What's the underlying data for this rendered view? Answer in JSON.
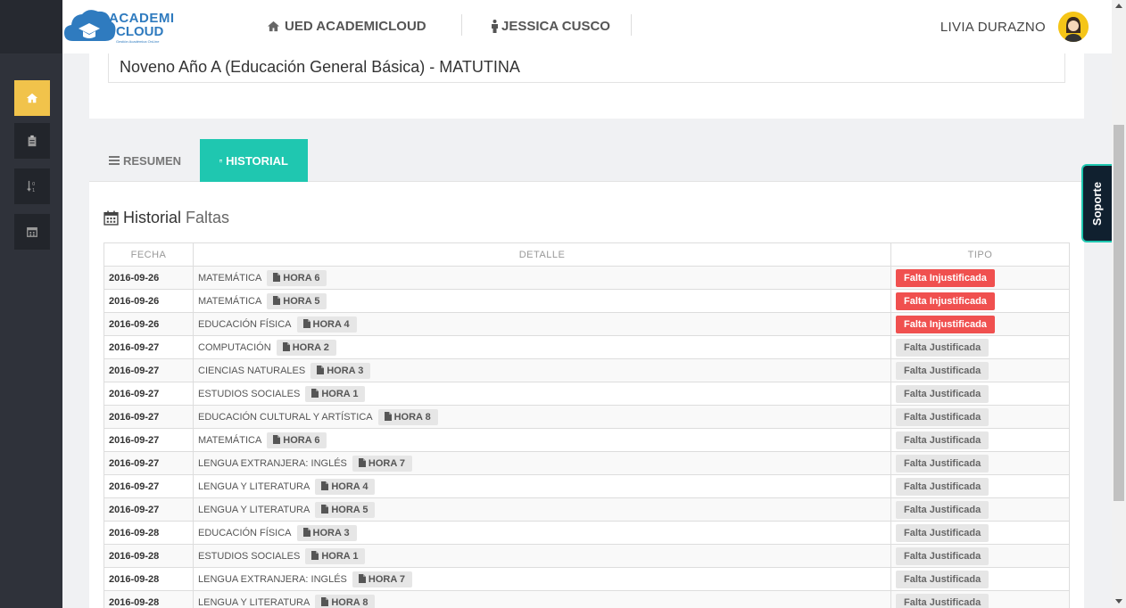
{
  "header": {
    "logo_line1": "ACADEMI",
    "logo_line2": "CLOUD",
    "logo_tagline": "Gestión Académica OnLine",
    "nav_institution": "UED ACADEMICLOUD",
    "nav_student": "JESSICA CUSCO",
    "user_name": "LIVIA DURAZNO"
  },
  "sidebar": {
    "items": [
      {
        "icon": "home-icon",
        "active": true
      },
      {
        "icon": "clipboard-icon",
        "active": false
      },
      {
        "icon": "sort-numeric-icon",
        "active": false
      },
      {
        "icon": "calendar-icon",
        "active": false
      }
    ]
  },
  "course": "Noveno Año A (Educación General Básica) - MATUTINA",
  "tabs": [
    {
      "label": "RESUMEN",
      "icon": "bars-icon",
      "active": false
    },
    {
      "label": "HISTORIAL",
      "icon": "calendar-icon",
      "active": true
    }
  ],
  "section": {
    "title": "Historial",
    "subtitle": "Faltas"
  },
  "table": {
    "headers": [
      "FECHA",
      "DETALLE",
      "TIPO"
    ],
    "rows": [
      {
        "date": "2016-09-26",
        "subject": "MATEMÁTICA",
        "hora": "HORA 6",
        "type": "Falta Injustificada",
        "kind": "inj"
      },
      {
        "date": "2016-09-26",
        "subject": "MATEMÁTICA",
        "hora": "HORA 5",
        "type": "Falta Injustificada",
        "kind": "inj"
      },
      {
        "date": "2016-09-26",
        "subject": "EDUCACIÓN FÍSICA",
        "hora": "HORA 4",
        "type": "Falta Injustificada",
        "kind": "inj"
      },
      {
        "date": "2016-09-27",
        "subject": "COMPUTACIÓN",
        "hora": "HORA 2",
        "type": "Falta Justificada",
        "kind": "jus"
      },
      {
        "date": "2016-09-27",
        "subject": "CIENCIAS NATURALES",
        "hora": "HORA 3",
        "type": "Falta Justificada",
        "kind": "jus"
      },
      {
        "date": "2016-09-27",
        "subject": "ESTUDIOS SOCIALES",
        "hora": "HORA 1",
        "type": "Falta Justificada",
        "kind": "jus"
      },
      {
        "date": "2016-09-27",
        "subject": "EDUCACIÓN CULTURAL Y ARTÍSTICA",
        "hora": "HORA 8",
        "type": "Falta Justificada",
        "kind": "jus"
      },
      {
        "date": "2016-09-27",
        "subject": "MATEMÁTICA",
        "hora": "HORA 6",
        "type": "Falta Justificada",
        "kind": "jus"
      },
      {
        "date": "2016-09-27",
        "subject": "LENGUA EXTRANJERA: INGLÉS",
        "hora": "HORA 7",
        "type": "Falta Justificada",
        "kind": "jus"
      },
      {
        "date": "2016-09-27",
        "subject": "LENGUA Y LITERATURA",
        "hora": "HORA 4",
        "type": "Falta Justificada",
        "kind": "jus"
      },
      {
        "date": "2016-09-27",
        "subject": "LENGUA Y LITERATURA",
        "hora": "HORA 5",
        "type": "Falta Justificada",
        "kind": "jus"
      },
      {
        "date": "2016-09-28",
        "subject": "EDUCACIÓN FÍSICA",
        "hora": "HORA 3",
        "type": "Falta Justificada",
        "kind": "jus"
      },
      {
        "date": "2016-09-28",
        "subject": "ESTUDIOS SOCIALES",
        "hora": "HORA 1",
        "type": "Falta Justificada",
        "kind": "jus"
      },
      {
        "date": "2016-09-28",
        "subject": "LENGUA EXTRANJERA: INGLÉS",
        "hora": "HORA 7",
        "type": "Falta Justificada",
        "kind": "jus"
      },
      {
        "date": "2016-09-28",
        "subject": "LENGUA Y LITERATURA",
        "hora": "HORA 8",
        "type": "Falta Justificada",
        "kind": "jus"
      }
    ]
  },
  "support_label": "Soporte",
  "colors": {
    "accent": "#1fc7b0",
    "sidebar_active": "#f1c34b",
    "danger": "#f0504f",
    "brand": "#2f7bbf"
  }
}
